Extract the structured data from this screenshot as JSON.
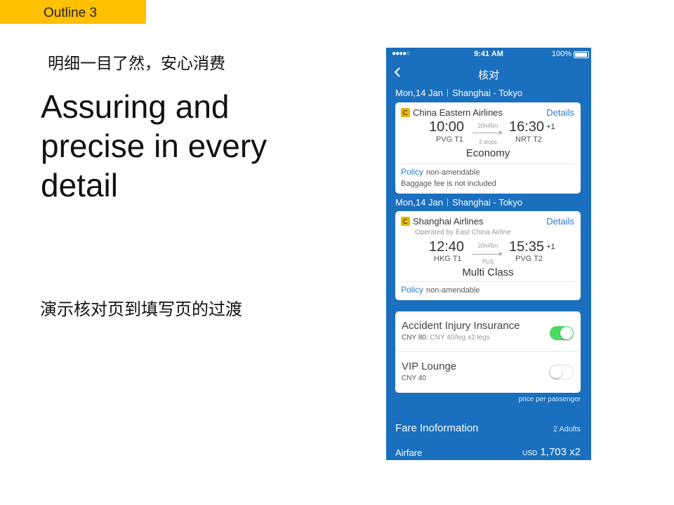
{
  "slide": {
    "outline_label": "Outline 3",
    "subtitle_cn": "明细一目了然，安心消费",
    "headline": "Assuring and precise in every detail",
    "note_cn": "演示核对页到填写页的过渡"
  },
  "colors": {
    "outline_bg": "#ffc000",
    "app_blue": "#1a6fbe",
    "link_blue": "#2a7bd0",
    "toggle_on": "#4cd964"
  },
  "status_bar": {
    "signal": "●●●●○",
    "time": "9:41 AM",
    "battery": "100%"
  },
  "nav": {
    "back_icon": "chevron-left-icon",
    "title": "核对"
  },
  "segments": [
    {
      "date": "Mon,14 Jan",
      "route": "Shanghai - Tokyo",
      "airline": "China Eastern Airlines",
      "operated_by": "",
      "details": "Details",
      "dep_time": "10:00",
      "dep_airport": "PVG T1",
      "duration": "20h45m",
      "stops": "2 stops",
      "arr_time": "16:30",
      "arr_day": "+1",
      "arr_airport": "NRT T2",
      "cabin": "Economy",
      "policy_label": "Policy",
      "policy_value": "non-amendable",
      "baggage": "Baggage fee is not included"
    },
    {
      "date": "Mon,14 Jan",
      "route": "Shanghai - Tokyo",
      "airline": "Shanghai Airlines",
      "operated_by": "Operated by East China Airline",
      "details": "Details",
      "dep_time": "12:40",
      "dep_airport": "HKG T1",
      "duration": "20h45m",
      "stops": "PUS",
      "arr_time": "15:35",
      "arr_day": "+1",
      "arr_airport": "PVG T2",
      "cabin": "Multi Class",
      "policy_label": "Policy",
      "policy_value": "non-amendable"
    }
  ],
  "addons": [
    {
      "title": "Accident Injury Insurance",
      "price": "CNY 80:",
      "price_detail": "CNY 40/leg x2 legs",
      "enabled": true
    },
    {
      "title": "VIP Lounge",
      "price": "CNY 40",
      "price_detail": "",
      "enabled": false
    }
  ],
  "price_note": "price per passenger",
  "fare": {
    "title": "Fare Inoformation",
    "passengers": "2 Adults",
    "airfare_label": "Airfare",
    "currency": "USD",
    "amount": "1,703",
    "multiplier": "x2"
  }
}
